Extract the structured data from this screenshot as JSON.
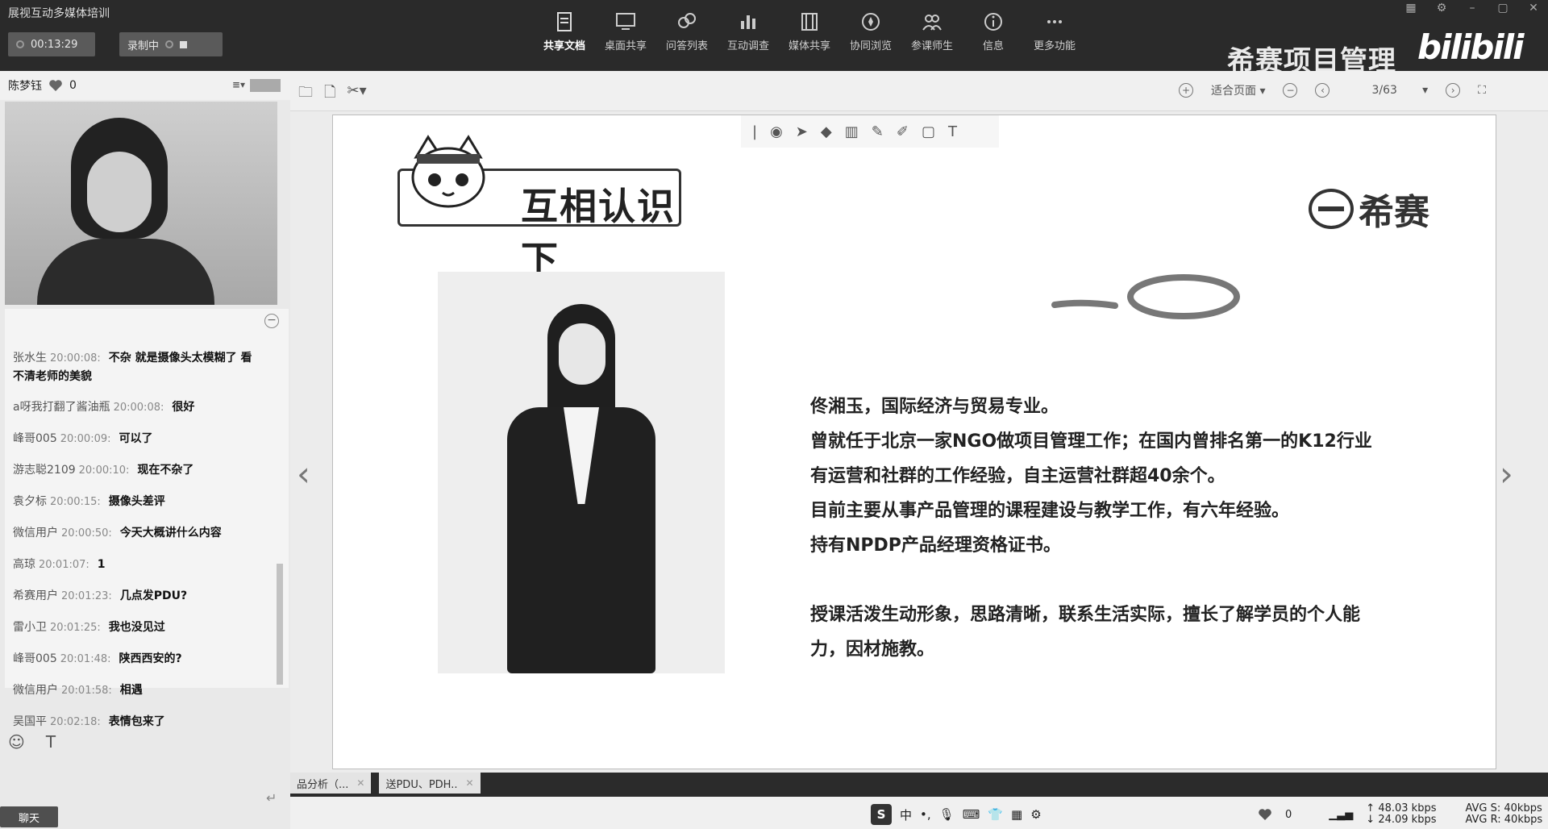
{
  "app": {
    "title": "展视互动多媒体培训",
    "timer": "00:13:29",
    "recording": "录制中"
  },
  "toolbar": {
    "items": [
      {
        "label": "共享文档",
        "icon": "document-share-icon"
      },
      {
        "label": "桌面共享",
        "icon": "desktop-share-icon"
      },
      {
        "label": "问答列表",
        "icon": "qa-icon"
      },
      {
        "label": "互动调查",
        "icon": "survey-chart-icon"
      },
      {
        "label": "媒体共享",
        "icon": "film-icon"
      },
      {
        "label": "协同浏览",
        "icon": "compass-icon"
      },
      {
        "label": "参课师生",
        "icon": "users-icon"
      },
      {
        "label": "信息",
        "icon": "info-icon"
      },
      {
        "label": "更多功能",
        "icon": "more-icon"
      }
    ]
  },
  "brand": {
    "name": "希赛项目管理",
    "watermark": "bilibili"
  },
  "speaker": {
    "name": "陈梦钰",
    "likes": "0"
  },
  "chat": {
    "messages": [
      {
        "user": "张水生",
        "time": "20:00:08:",
        "text": "不杂 就是摄像头太模糊了 看不清老师的美貌"
      },
      {
        "user": "a呀我打翻了酱油瓶",
        "time": "20:00:08:",
        "text": "很好"
      },
      {
        "user": "峰哥005",
        "time": "20:00:09:",
        "text": "可以了"
      },
      {
        "user": "游志聪2109",
        "time": "20:00:10:",
        "text": "现在不杂了"
      },
      {
        "user": "袁夕标",
        "time": "20:00:15:",
        "text": "摄像头差评"
      },
      {
        "user": "微信用户",
        "time": "20:00:50:",
        "text": "今天大概讲什么内容"
      },
      {
        "user": "高琼",
        "time": "20:01:07:",
        "text": "1"
      },
      {
        "user": "希赛用户",
        "time": "20:01:23:",
        "text": "几点发PDU?"
      },
      {
        "user": "雷小卫",
        "time": "20:01:25:",
        "text": "我也没见过"
      },
      {
        "user": "峰哥005",
        "time": "20:01:48:",
        "text": "陕西西安的?"
      },
      {
        "user": "微信用户",
        "time": "20:01:58:",
        "text": "相遇"
      },
      {
        "user": "吴国平",
        "time": "20:02:18:",
        "text": "表情包来了"
      }
    ],
    "send_button": "聊天"
  },
  "docbar": {
    "fit_option": "适合页面",
    "page": "3/63"
  },
  "slide": {
    "banner": "互相认识下",
    "logo_text": "希赛",
    "bio_paragraph1": [
      "佟湘玉，国际经济与贸易专业。",
      "曾就任于北京一家NGO做项目管理工作；在国内曾排名第一的K12行业",
      "有运营和社群的工作经验，自主运营社群超40余个。",
      "目前主要从事产品管理的课程建设与教学工作，有六年经验。",
      "持有NPDP产品经理资格证书。"
    ],
    "bio_paragraph2": [
      "授课活泼生动形象，思路清晰，联系生活实际，擅长了解学员的个人能",
      "力，因材施教。"
    ]
  },
  "tabs": [
    {
      "label": "品分析（..."
    },
    {
      "label": "送PDU、PDH.."
    }
  ],
  "ime": {
    "logo": "S",
    "lang": "中"
  },
  "status": {
    "likes": "0",
    "up": "48.03 kbps",
    "down": "24.09 kbps",
    "avg_s": "AVG S: 40kbps",
    "avg_r": "AVG R: 40kbps"
  }
}
